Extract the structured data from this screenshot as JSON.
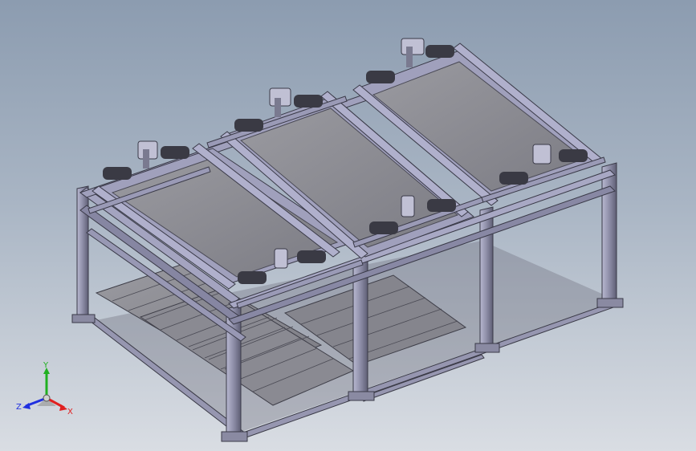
{
  "viewport": {
    "background_top": "#8c9cb0",
    "background_bottom": "#d9dde3"
  },
  "model": {
    "frame_color": "#9c9cb8",
    "deck_color": "#8e8e94",
    "rail_color": "#a6a6c2",
    "motor_color": "#3a3a44"
  },
  "triad": {
    "x_label": "X",
    "y_label": "Y",
    "z_label": "Z",
    "x_color": "#e02020",
    "y_color": "#20b020",
    "z_color": "#2030e0"
  }
}
